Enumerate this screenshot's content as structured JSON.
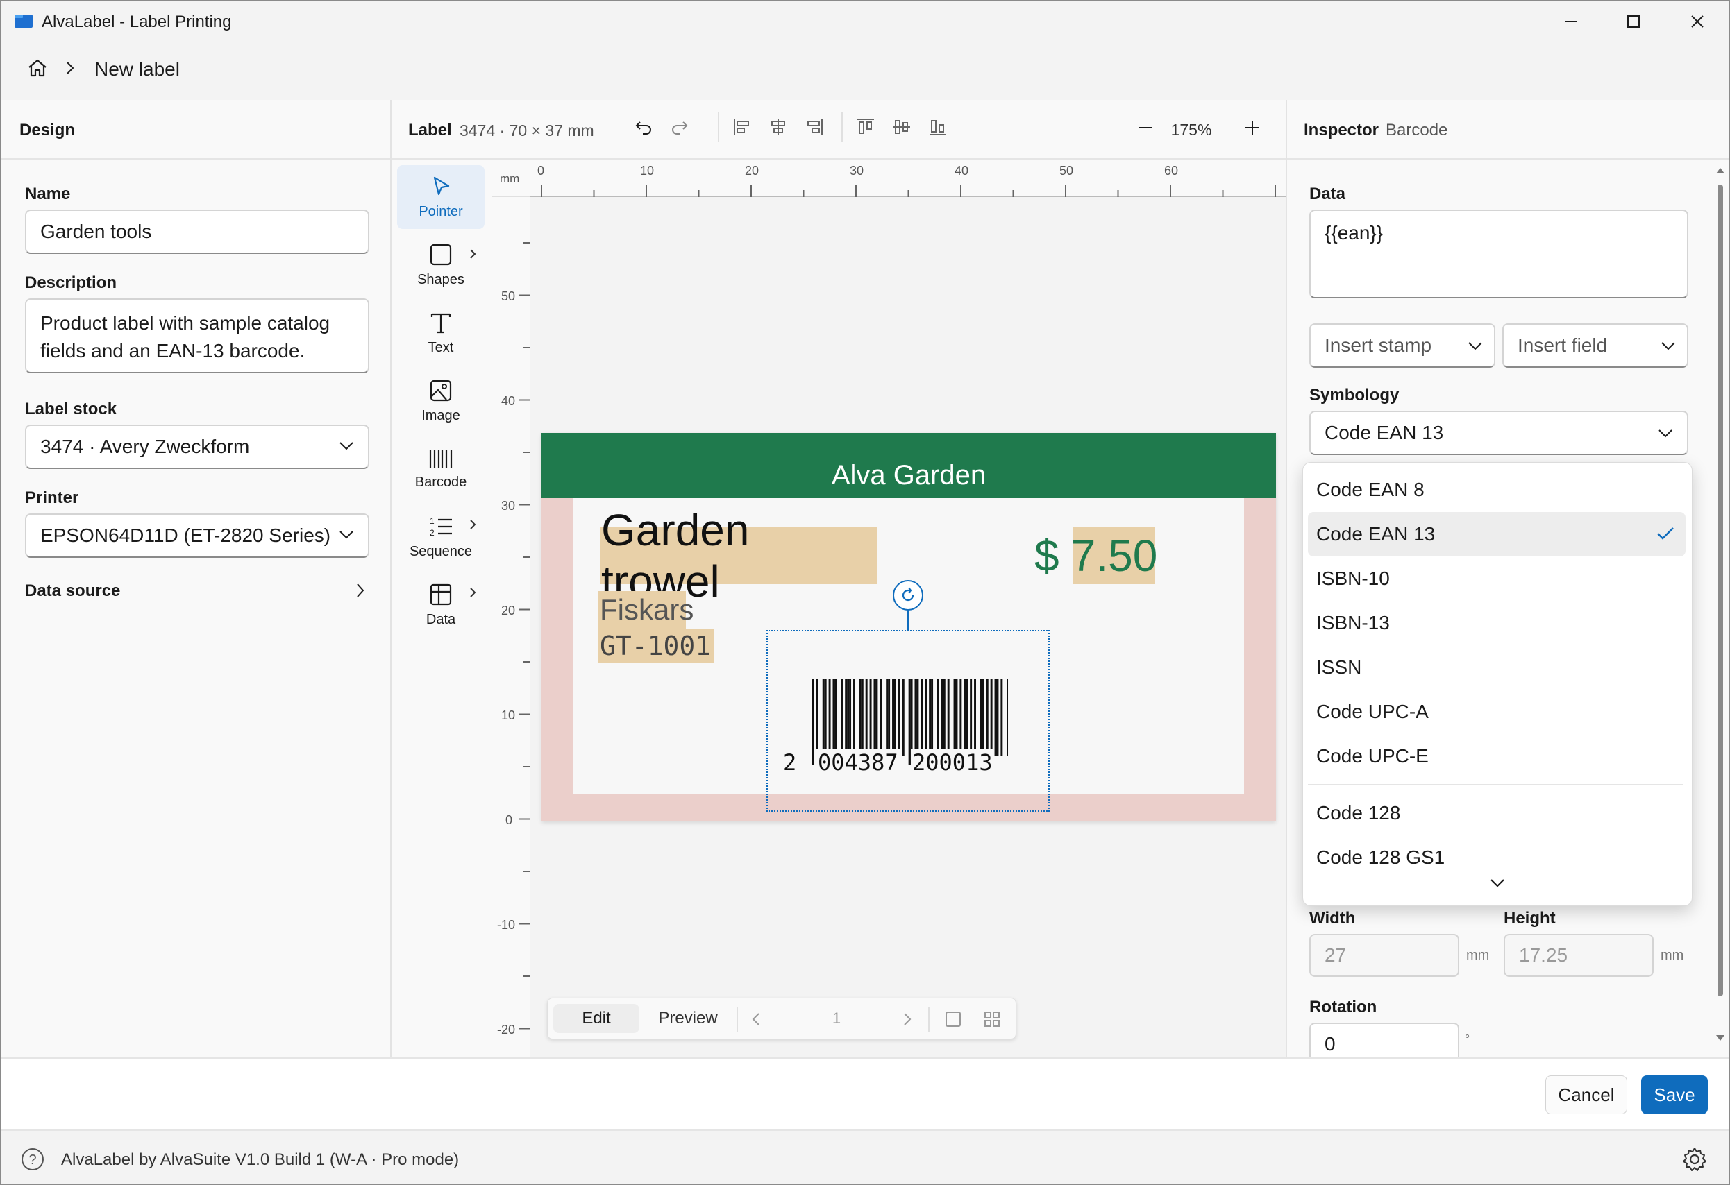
{
  "window": {
    "title": "AlvaLabel - Label Printing"
  },
  "breadcrumb": {
    "current": "New label"
  },
  "design": {
    "header": "Design",
    "name_label": "Name",
    "name_value": "Garden tools",
    "description_label": "Description",
    "description_value": "Product label with sample catalog fields and an EAN-13 barcode.",
    "label_stock_label": "Label stock",
    "label_stock_value": "3474 · Avery Zweckform",
    "printer_label": "Printer",
    "printer_value": "EPSON64D11D (ET-2820 Series)",
    "data_source_label": "Data source"
  },
  "toolbar": {
    "label_title": "Label",
    "label_info": "3474 · 70 × 37 mm",
    "zoom": "175%"
  },
  "tools": [
    {
      "label": "Pointer"
    },
    {
      "label": "Shapes"
    },
    {
      "label": "Text"
    },
    {
      "label": "Image"
    },
    {
      "label": "Barcode"
    },
    {
      "label": "Sequence"
    },
    {
      "label": "Data"
    }
  ],
  "ruler": {
    "unit": "mm",
    "h_ticks": [
      "0",
      "10",
      "20",
      "30",
      "40",
      "50",
      "60"
    ],
    "v_ticks": [
      "50",
      "40",
      "30",
      "20",
      "10",
      "0",
      "-10",
      "-20"
    ]
  },
  "label": {
    "header": "Alva Garden",
    "product": "Garden trowel",
    "currency": "$",
    "price": "7.50",
    "brand": "Fiskars",
    "sku": "GT-1001",
    "barcode_digits": [
      "2",
      "004387",
      "200013"
    ],
    "colors": {
      "header": "#1f7a4d",
      "bleed": "#ebcfcb",
      "field": "#e8d0a8",
      "price": "#1f7a4d"
    }
  },
  "bottombar": {
    "edit": "Edit",
    "preview": "Preview",
    "page": "1"
  },
  "inspector": {
    "title": "Inspector",
    "subtitle": "Barcode",
    "data_label": "Data",
    "data_value": "{{ean}}",
    "insert_stamp": "Insert stamp",
    "insert_field": "Insert field",
    "symbology_label": "Symbology",
    "symbology_value": "Code EAN 13",
    "symbology_options": [
      "Code EAN 8",
      "Code EAN 13",
      "ISBN-10",
      "ISBN-13",
      "ISSN",
      "Code UPC-A",
      "Code UPC-E",
      "Code 128",
      "Code 128 GS1"
    ],
    "selected_option": "Code EAN 13",
    "width_label": "Width",
    "width_value": "27",
    "width_unit": "mm",
    "height_label": "Height",
    "height_value": "17.25",
    "height_unit": "mm",
    "rotation_label": "Rotation",
    "rotation_value": "0",
    "rotation_unit": "°"
  },
  "footer": {
    "cancel": "Cancel",
    "save": "Save"
  },
  "status": {
    "text": "AlvaLabel by AlvaSuite V1.0 Build 1 (W-A · Pro mode)"
  },
  "accent": "#0f6cbd"
}
